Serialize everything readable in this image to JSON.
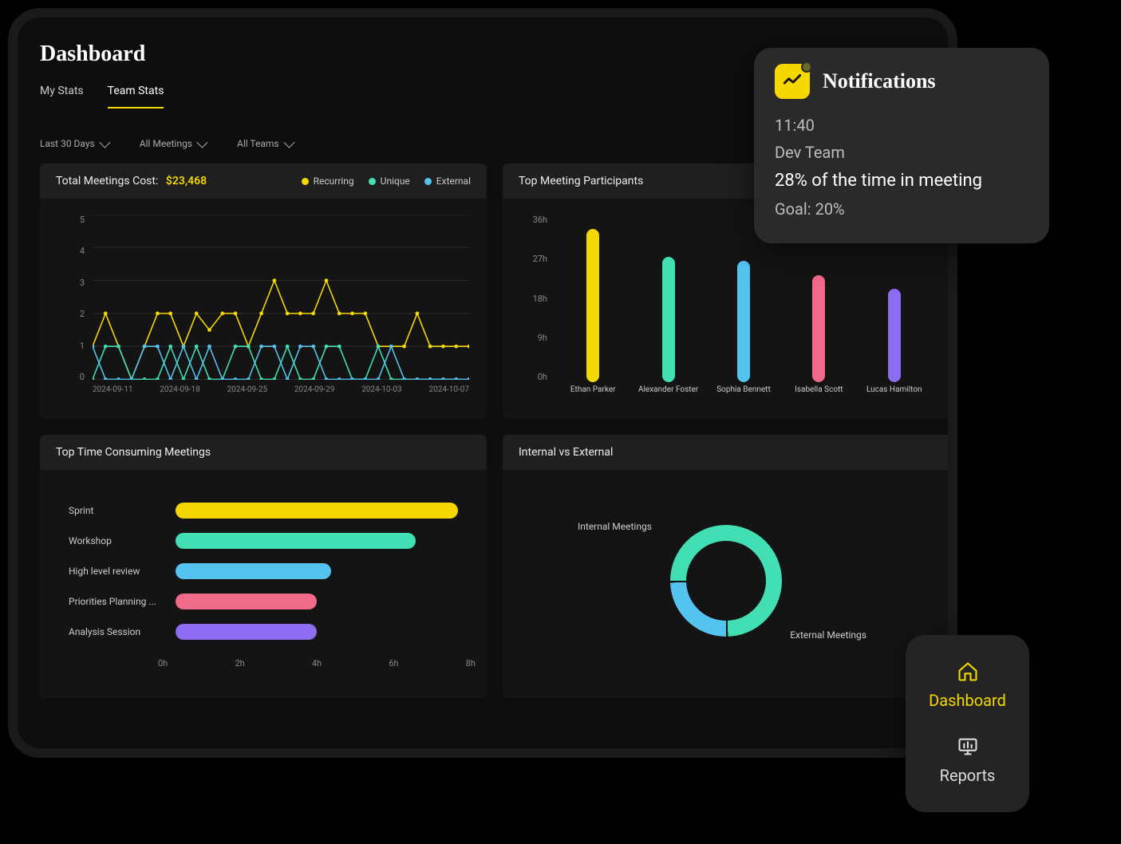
{
  "page": {
    "title": "Dashboard"
  },
  "tabs": [
    {
      "label": "My Stats",
      "active": false
    },
    {
      "label": "Team Stats",
      "active": true
    }
  ],
  "filters": {
    "date_range": "Last 30 Days",
    "meeting_type": "All Meetings",
    "teams": "All Teams"
  },
  "cards": {
    "cost": {
      "title": "Total Meetings Cost:",
      "value": "$23,468",
      "legend": [
        {
          "label": "Recurring",
          "color": "#f5d800"
        },
        {
          "label": "Unique",
          "color": "#42dfb4"
        },
        {
          "label": "External",
          "color": "#55c3f0"
        }
      ]
    },
    "participants": {
      "title": "Top Meeting Participants"
    },
    "time_consuming": {
      "title": "Top Time Consuming Meetings"
    },
    "internal_external": {
      "title": "Internal vs External",
      "labels": {
        "internal": "Internal Meetings",
        "external": "External Meetings"
      }
    }
  },
  "notification": {
    "title": "Notifications",
    "time": "11:40",
    "team": "Dev Team",
    "main": "28% of the time in meeting",
    "goal": "Goal: 20%"
  },
  "mini_nav": {
    "items": [
      {
        "label": "Dashboard",
        "active": true
      },
      {
        "label": "Reports",
        "active": false
      }
    ]
  },
  "chart_data": [
    {
      "id": "meetings_cost",
      "type": "line",
      "title": "Total Meetings Cost: $23,468",
      "xlabel": "",
      "ylabel": "",
      "ylim": [
        0,
        5
      ],
      "yticks": [
        0,
        1,
        2,
        3,
        4,
        5
      ],
      "xticks": [
        "2024-09-11",
        "2024-09-18",
        "2024-09-25",
        "2024-09-29",
        "2024-10-03",
        "2024-10-07"
      ],
      "x": [
        0,
        1,
        2,
        3,
        4,
        5,
        6,
        7,
        8,
        9,
        10,
        11,
        12,
        13,
        14,
        15,
        16,
        17,
        18,
        19,
        20,
        21,
        22,
        23,
        24,
        25,
        26,
        27,
        28,
        29
      ],
      "series": [
        {
          "name": "Recurring",
          "color": "#f5d800",
          "values": [
            1,
            2,
            1,
            0,
            1,
            2,
            2,
            1,
            2,
            1.5,
            2,
            2,
            1,
            2,
            3,
            2,
            2,
            2,
            3,
            2,
            2,
            2,
            1,
            1,
            1,
            2,
            1,
            1,
            1,
            1
          ]
        },
        {
          "name": "Unique",
          "color": "#42dfb4",
          "values": [
            0,
            1,
            1,
            0,
            0,
            0,
            1,
            0,
            1,
            0,
            0,
            1,
            1,
            0,
            0,
            1,
            0,
            0,
            1,
            1,
            0,
            0,
            1,
            0,
            0,
            0,
            0,
            0,
            0,
            0
          ]
        },
        {
          "name": "External",
          "color": "#55c3f0",
          "values": [
            1,
            0,
            0,
            0,
            1,
            1,
            0,
            1,
            0,
            1,
            0,
            0,
            0,
            1,
            1,
            0,
            1,
            1,
            0,
            0,
            0,
            0,
            0,
            1,
            0,
            0,
            0,
            0,
            0,
            0
          ]
        }
      ]
    },
    {
      "id": "top_participants",
      "type": "bar",
      "title": "Top Meeting Participants",
      "ylabel": "hours",
      "ylim": [
        0,
        36
      ],
      "yticks": [
        "0h",
        "9h",
        "18h",
        "27h",
        "36h"
      ],
      "categories": [
        "Ethan Parker",
        "Alexander Foster",
        "Sophia Bennett",
        "Isabella Scott",
        "Lucas Hamilton"
      ],
      "values": [
        33,
        27,
        26,
        23,
        20
      ],
      "colors": [
        "#f5d800",
        "#42dfb4",
        "#55c3f0",
        "#f06a8a",
        "#8c6cf0"
      ]
    },
    {
      "id": "time_consuming_meetings",
      "type": "bar",
      "orientation": "horizontal",
      "title": "Top Time Consuming Meetings",
      "xlabel": "hours",
      "xlim": [
        0,
        8
      ],
      "xticks": [
        "0h",
        "2h",
        "4h",
        "6h",
        "8h"
      ],
      "categories": [
        "Sprint",
        "Workshop",
        "High level review",
        "Priorities Planning ...",
        "Analysis Session"
      ],
      "values": [
        8.0,
        6.8,
        4.4,
        4.0,
        4.0
      ],
      "colors": [
        "#f5d800",
        "#42dfb4",
        "#55c3f0",
        "#f06a8a",
        "#8c6cf0"
      ]
    },
    {
      "id": "internal_vs_external",
      "type": "pie",
      "title": "Internal vs External",
      "categories": [
        "Internal Meetings",
        "External Meetings"
      ],
      "values": [
        75,
        25
      ],
      "colors": [
        "#42dfb4",
        "#55c3f0"
      ]
    }
  ]
}
